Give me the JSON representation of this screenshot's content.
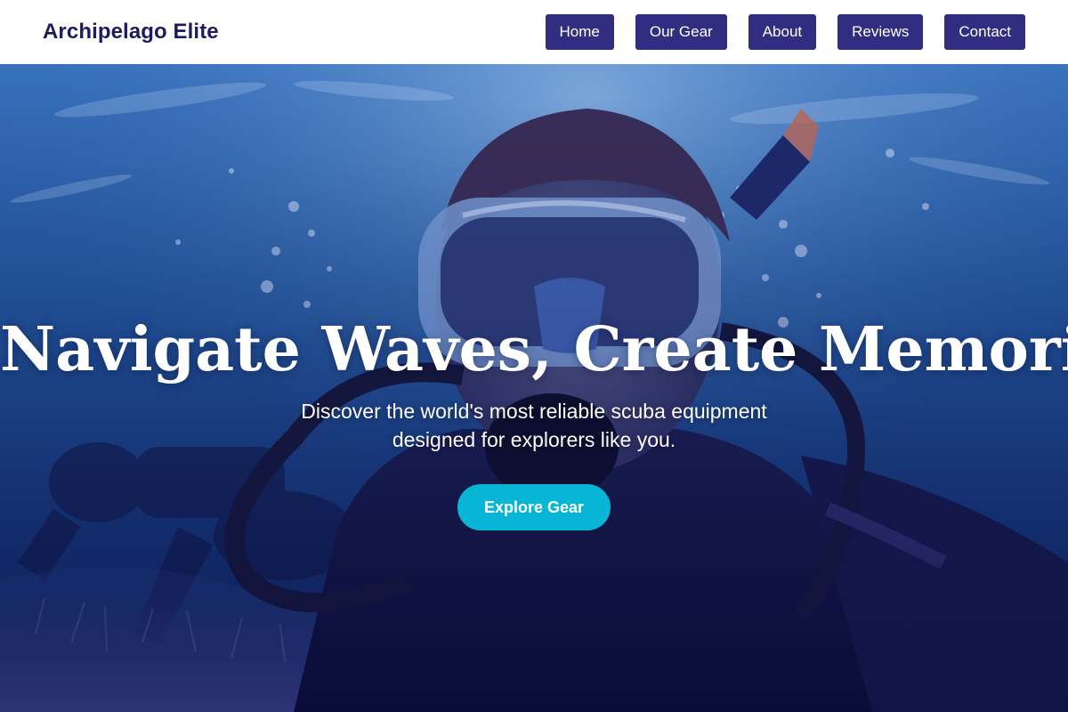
{
  "brand": {
    "name": "Archipelago Elite"
  },
  "nav": {
    "items": [
      {
        "label": "Home"
      },
      {
        "label": "Our Gear"
      },
      {
        "label": "About"
      },
      {
        "label": "Reviews"
      },
      {
        "label": "Contact"
      }
    ]
  },
  "hero": {
    "title": "Navigate Waves, Create Memories.",
    "subtitle": "Discover the world's most reliable scuba equipment designed for explorers like you.",
    "cta_label": "Explore Gear",
    "background": "underwater photo of a scuba diver wearing a mask and regulator"
  },
  "colors": {
    "nav_bg": "#ffffff",
    "brand_text": "#1e1b5e",
    "nav_button": "#312e81",
    "cta": "#06b6d4",
    "ocean_deep": "#0b1e5a",
    "ocean_mid": "#1e4f9a"
  }
}
